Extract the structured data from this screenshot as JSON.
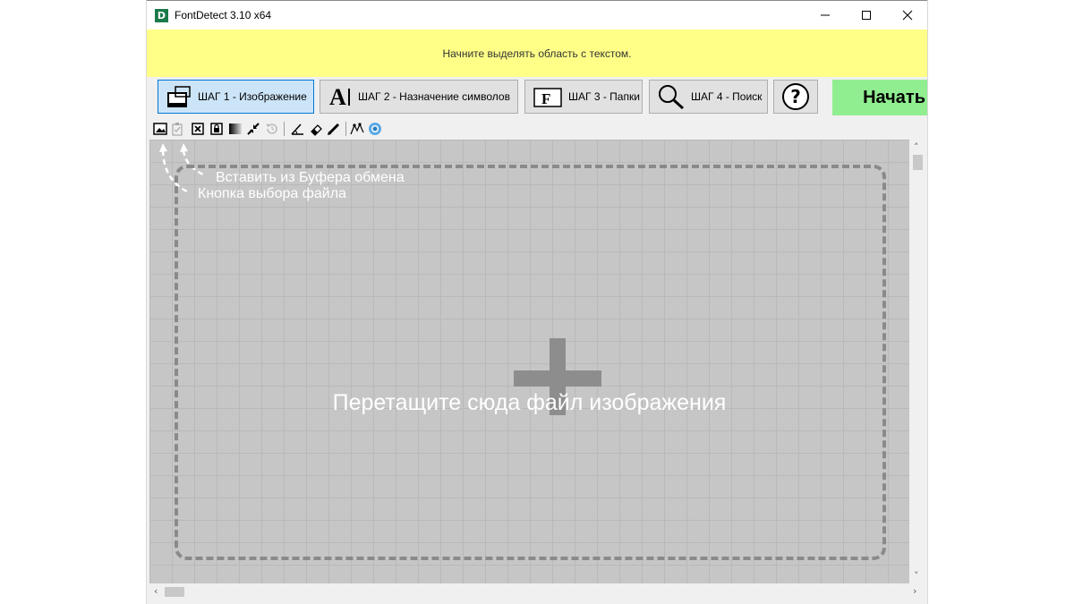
{
  "window": {
    "title": "FontDetect 3.10 x64",
    "icon_letter": "D"
  },
  "banner": {
    "text": "Начните выделять область с текстом."
  },
  "steps": {
    "step1_label": "ШАГ 1 - Изображение",
    "step2_label": "ШАГ 2 - Назначение символов",
    "step3_label": "ШАГ 3 - Папки",
    "step4_label": "ШАГ 4 - Поиск",
    "help_label": "?",
    "start_label": "Начать",
    "step2_icon_letter": "A",
    "step3_icon_letter": "F"
  },
  "toolbar_icons": [
    "open-image-icon",
    "paste-clipboard-icon",
    "close-icon",
    "lock-icon",
    "gradient-icon",
    "collapse-icon",
    "rotate-icon",
    "angle-icon",
    "eraser-icon",
    "pencil-icon",
    "path-icon",
    "color-wheel-icon"
  ],
  "canvas": {
    "drop_text": "Перетащите сюда файл изображения",
    "hint_clipboard": "Вставить из Буфера обмена",
    "hint_file": "Кнопка выбора файла"
  },
  "colors": {
    "banner": "#ffff88",
    "start_button": "#90ee90",
    "active_step": "#cce4f7",
    "canvas": "#c6c6c6"
  }
}
